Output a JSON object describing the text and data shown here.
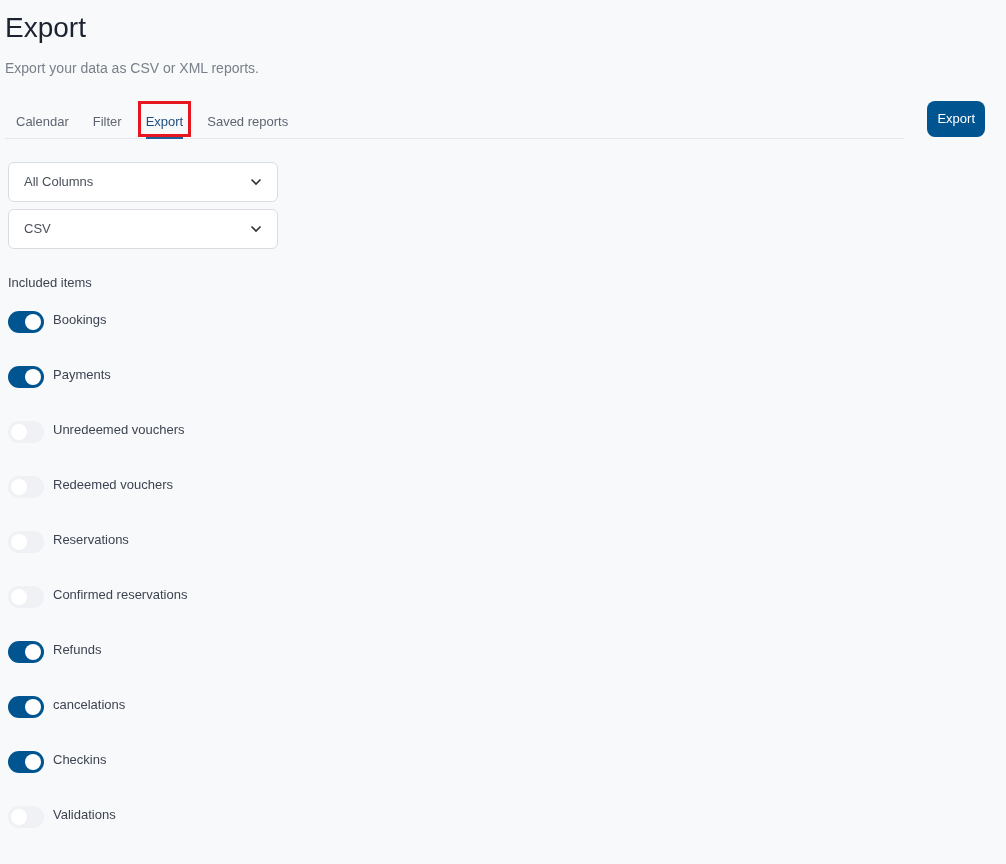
{
  "page": {
    "title": "Export",
    "subtitle": "Export your data as CSV or XML reports."
  },
  "tabs": [
    {
      "label": "Calendar",
      "selected": false,
      "highlighted": false
    },
    {
      "label": "Filter",
      "selected": false,
      "highlighted": false
    },
    {
      "label": "Export",
      "selected": true,
      "highlighted": true
    },
    {
      "label": "Saved reports",
      "selected": false,
      "highlighted": false
    }
  ],
  "export_button": "Export",
  "selects": [
    {
      "value": "All Columns"
    },
    {
      "value": "CSV"
    }
  ],
  "included_items": {
    "heading": "Included items",
    "items": [
      {
        "label": "Bookings",
        "on": true
      },
      {
        "label": "Payments",
        "on": true
      },
      {
        "label": "Unredeemed vouchers",
        "on": false
      },
      {
        "label": "Redeemed vouchers",
        "on": false
      },
      {
        "label": "Reservations",
        "on": false
      },
      {
        "label": "Confirmed reservations",
        "on": false
      },
      {
        "label": "Refunds",
        "on": true
      },
      {
        "label": "cancelations",
        "on": true
      },
      {
        "label": "Checkins",
        "on": true
      },
      {
        "label": "Validations",
        "on": false
      }
    ]
  }
}
